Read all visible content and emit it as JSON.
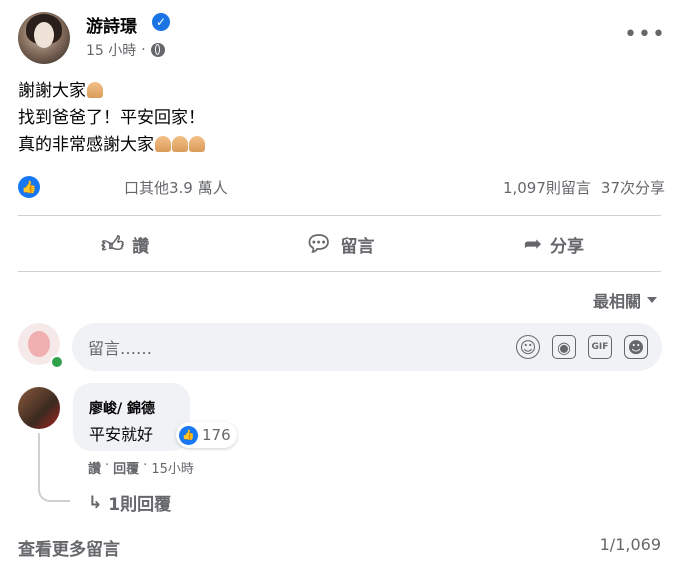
{
  "post": {
    "author": "游詩璟",
    "time": "15 小時",
    "lines": [
      "謝謝大家",
      "找到爸爸了！平安回家！",
      "真的非常感謝大家"
    ],
    "icons": {
      "verified": "verified-badge-icon",
      "audience": "globe-icon",
      "more": "more-options-icon",
      "emoji": "folded-hands-emoji"
    }
  },
  "reactions": {
    "summary": "口其他3.9 萬人",
    "comments": "1,097則留言",
    "shares": "37次分享"
  },
  "actions": {
    "like": "讚",
    "comment": "留言",
    "share": "分享"
  },
  "sort": {
    "label": "最相關"
  },
  "composer": {
    "placeholder": "留言……"
  },
  "comment": {
    "author": "廖峻/ 錦德",
    "text": "平安就好",
    "reaction_count": "176",
    "like": "讚",
    "reply": "回覆",
    "time": "15小時",
    "replies": "1則回覆"
  },
  "footer": {
    "more_comments": "查看更多留言",
    "count": "1/1,069"
  },
  "colors": {
    "accent": "#1877f2",
    "secondary_text": "#65676b",
    "bubble": "#f0f2f5"
  }
}
